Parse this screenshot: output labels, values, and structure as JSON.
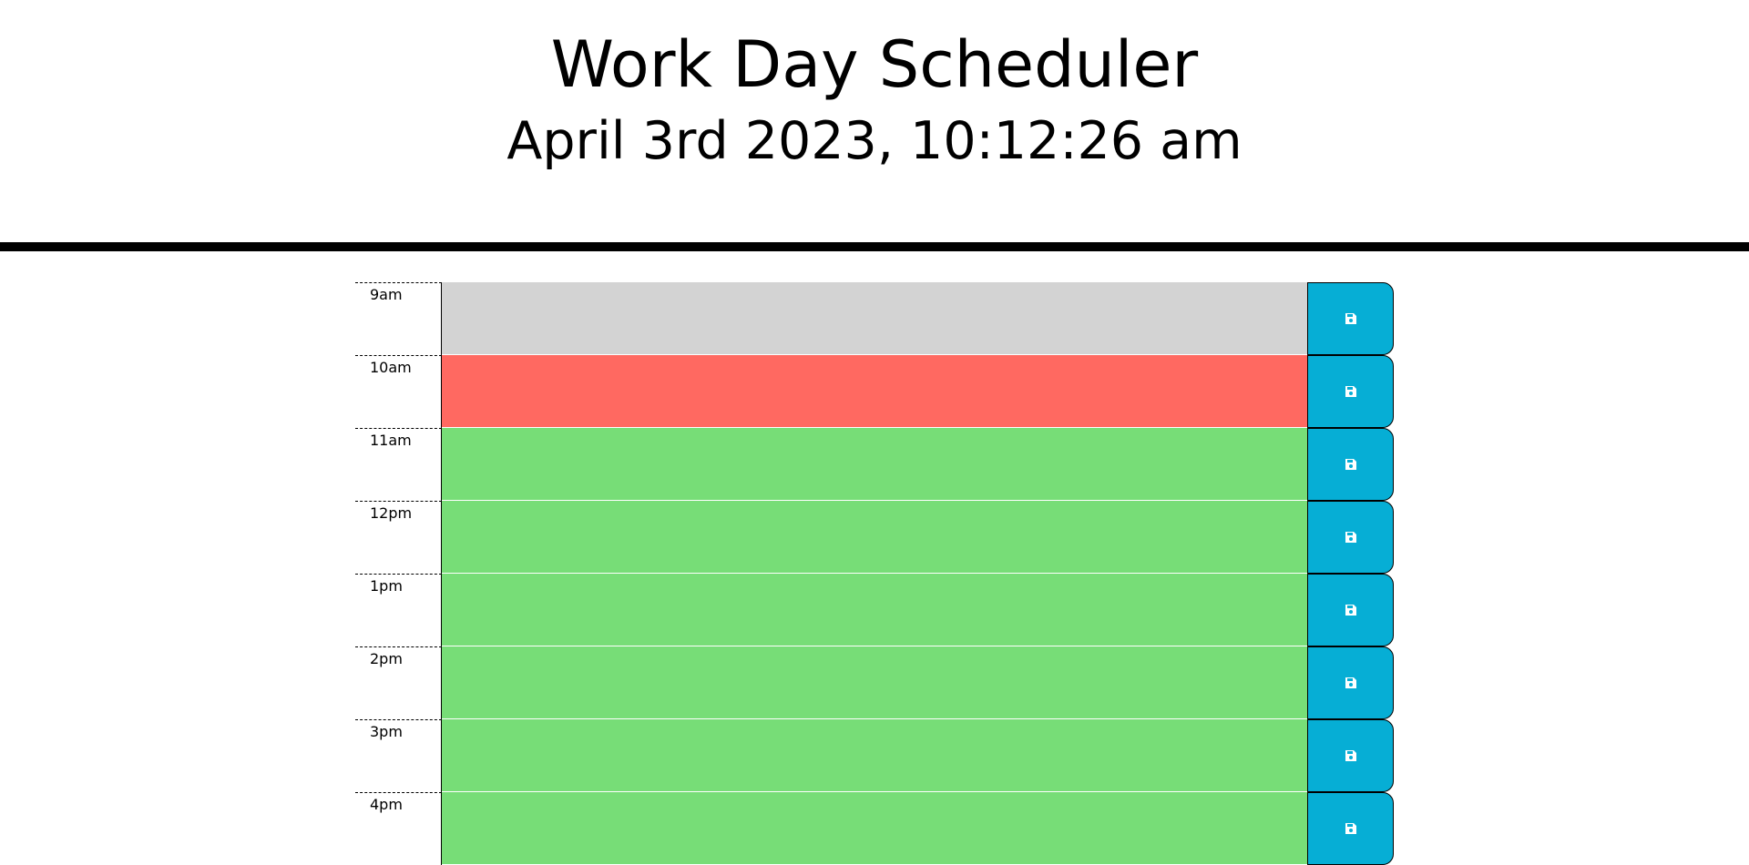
{
  "header": {
    "title": "Work Day Scheduler",
    "current_date": "April 3rd 2023, 10:12:26 am"
  },
  "rows": [
    {
      "hour": "9am",
      "status": "past",
      "text": ""
    },
    {
      "hour": "10am",
      "status": "present",
      "text": ""
    },
    {
      "hour": "11am",
      "status": "future",
      "text": ""
    },
    {
      "hour": "12pm",
      "status": "future",
      "text": ""
    },
    {
      "hour": "1pm",
      "status": "future",
      "text": ""
    },
    {
      "hour": "2pm",
      "status": "future",
      "text": ""
    },
    {
      "hour": "3pm",
      "status": "future",
      "text": ""
    },
    {
      "hour": "4pm",
      "status": "future",
      "text": ""
    }
  ],
  "colors": {
    "past": "#d3d3d3",
    "present": "#ff6961",
    "future": "#77dd77",
    "save_button": "#06aed5"
  },
  "icons": {
    "save": "floppy-disk-icon"
  }
}
